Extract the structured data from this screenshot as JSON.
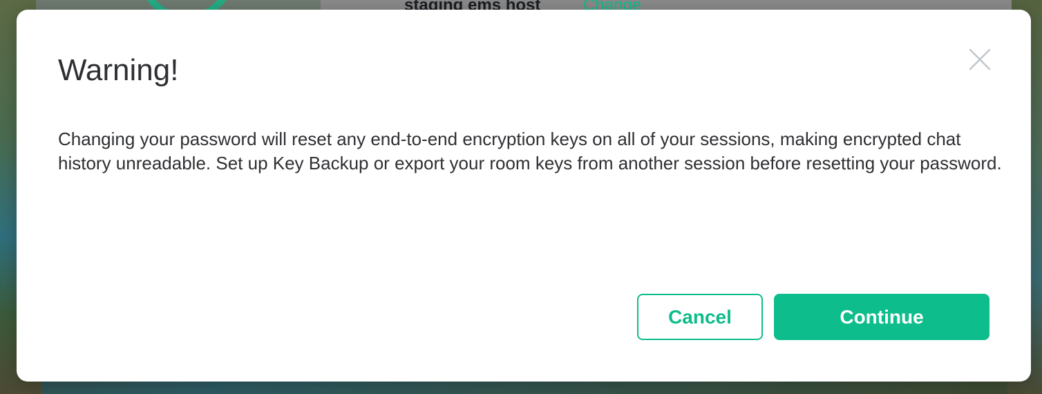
{
  "background": {
    "server_name": "staging ems host",
    "change_link": "Change"
  },
  "dialog": {
    "title": "Warning!",
    "close_icon": "close-icon",
    "body": "Changing your password will reset any end-to-end encryption keys on all of your sessions, making encrypted chat history unreadable. Set up Key Backup or export your room keys from another session before resetting your password.",
    "cancel_label": "Cancel",
    "continue_label": "Continue"
  },
  "colors": {
    "accent": "#0dbd8b",
    "text": "#2e2f32",
    "dialog_background": "#ffffff"
  }
}
